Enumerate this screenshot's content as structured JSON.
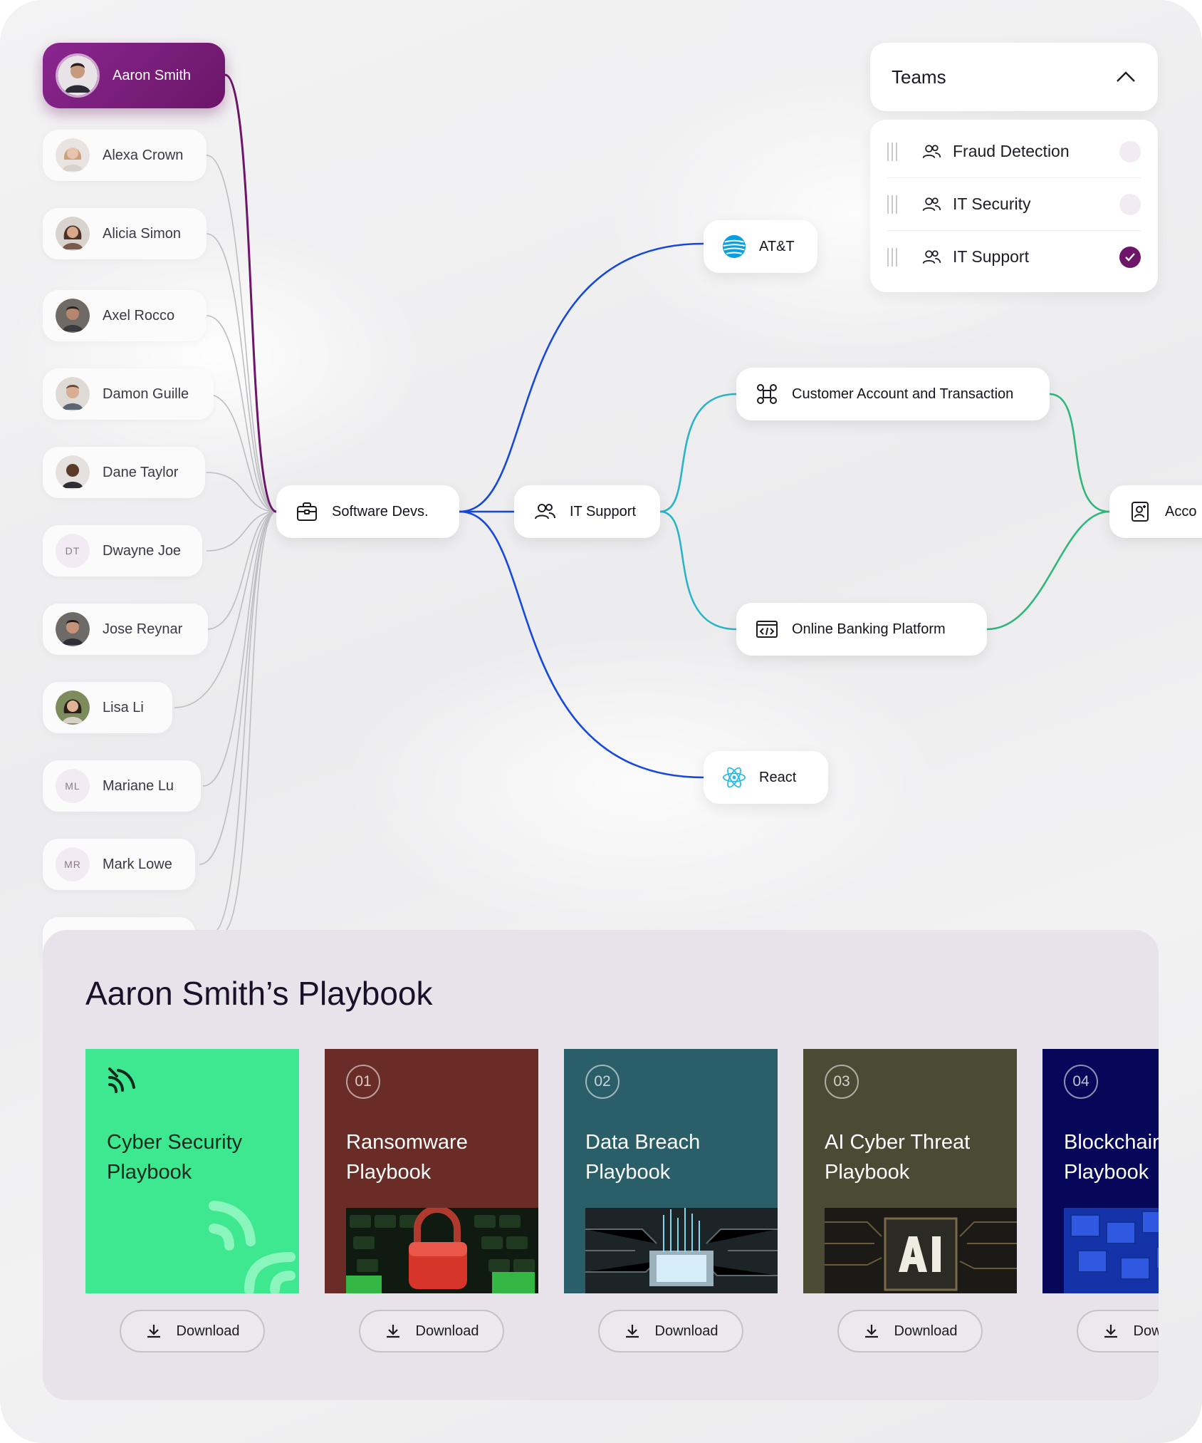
{
  "people": [
    {
      "name": "Aaron Smith",
      "initials": "",
      "selected": true
    },
    {
      "name": "Alexa Crown",
      "initials": ""
    },
    {
      "name": "Alicia Simon",
      "initials": ""
    },
    {
      "name": "Axel Rocco",
      "initials": ""
    },
    {
      "name": "Damon Guille",
      "initials": ""
    },
    {
      "name": "Dane Taylor",
      "initials": ""
    },
    {
      "name": "Dwayne Joe",
      "initials": "DT"
    },
    {
      "name": "Jose Reynar",
      "initials": ""
    },
    {
      "name": "Lisa Li",
      "initials": ""
    },
    {
      "name": "Mariane Lu",
      "initials": "ML"
    },
    {
      "name": "Mark Lowe",
      "initials": "MR"
    }
  ],
  "nodes": {
    "software": "Software Devs.",
    "itsupport": "IT Support",
    "att": "AT&T",
    "customer": "Customer Account and Transaction",
    "banking": "Online Banking Platform",
    "react": "React",
    "acco": "Acco"
  },
  "teams": {
    "title": "Teams",
    "items": [
      {
        "label": "Fraud Detection",
        "checked": false
      },
      {
        "label": "IT Security",
        "checked": false
      },
      {
        "label": "IT Support",
        "checked": true
      }
    ]
  },
  "playbook": {
    "title": "Aaron Smith’s Playbook",
    "cards": [
      {
        "num": "",
        "title_1": "Cyber Security",
        "title_2": "Playbook",
        "bg": "#3de891",
        "download": "Download"
      },
      {
        "num": "01",
        "title_1": "Ransomware",
        "title_2": "Playbook",
        "bg": "#6a2c27",
        "download": "Download"
      },
      {
        "num": "02",
        "title_1": "Data Breach",
        "title_2": "Playbook",
        "bg": "#2a5e69",
        "download": "Download"
      },
      {
        "num": "03",
        "title_1": "AI Cyber Threat",
        "title_2": "Playbook",
        "bg": "#4b4a35",
        "download": "Download"
      },
      {
        "num": "04",
        "title_1": "Blockchain",
        "title_2": "Playbook",
        "bg": "#07075a",
        "download": "Download"
      }
    ]
  },
  "colors": {
    "accent_purple": "#6d1669",
    "line_blue": "#1647e0",
    "line_teal": "#29b4c8",
    "line_green": "#2fb67c",
    "line_gray": "#bdbdc2"
  },
  "icons": {
    "att": "att-logo-icon",
    "react": "react-icon",
    "software": "briefcase-icon",
    "itsupport": "users-icon",
    "customer": "command-icon",
    "banking": "code-window-icon",
    "acco": "contact-book-icon"
  }
}
